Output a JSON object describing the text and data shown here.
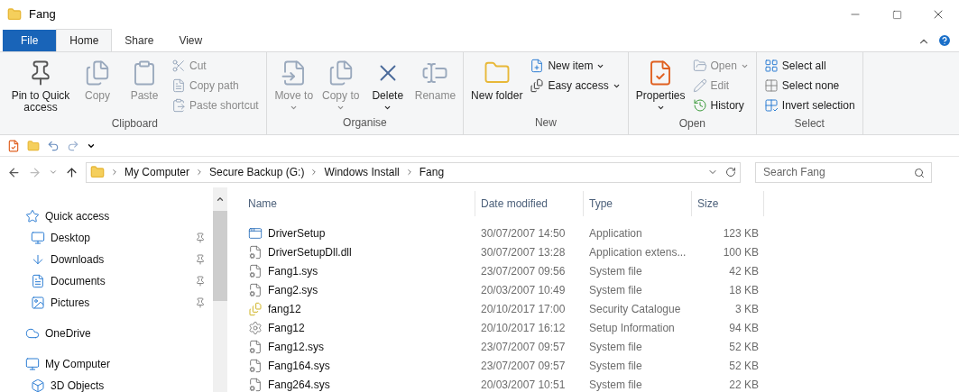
{
  "window": {
    "title": "Fang"
  },
  "tabs": [
    {
      "label": "File",
      "kind": "file",
      "selected": false
    },
    {
      "label": "Home",
      "kind": "tab",
      "selected": true
    },
    {
      "label": "Share",
      "kind": "tab",
      "selected": false
    },
    {
      "label": "View",
      "kind": "tab",
      "selected": false
    }
  ],
  "ribbon": [
    {
      "label": "Clipboard",
      "items": [
        {
          "kind": "large",
          "label": "Pin to Quick access",
          "disabled": false,
          "dropdown": false
        },
        {
          "kind": "large",
          "label": "Copy",
          "disabled": true,
          "dropdown": false
        },
        {
          "kind": "large",
          "label": "Paste",
          "disabled": true,
          "dropdown": false
        },
        {
          "kind": "small",
          "label": "Cut",
          "disabled": true,
          "dropdown": false
        },
        {
          "kind": "small",
          "label": "Copy path",
          "disabled": true,
          "dropdown": false
        },
        {
          "kind": "small",
          "label": "Paste shortcut",
          "disabled": true,
          "dropdown": false
        }
      ]
    },
    {
      "label": "Organise",
      "items": [
        {
          "kind": "large",
          "label": "Move to",
          "disabled": true,
          "dropdown": true
        },
        {
          "kind": "large",
          "label": "Copy to",
          "disabled": true,
          "dropdown": true
        },
        {
          "kind": "large",
          "label": "Delete",
          "disabled": false,
          "dropdown": true
        },
        {
          "kind": "large",
          "label": "Rename",
          "disabled": true,
          "dropdown": false
        }
      ]
    },
    {
      "label": "New",
      "items": [
        {
          "kind": "large",
          "label": "New folder",
          "disabled": false,
          "dropdown": false
        },
        {
          "kind": "small",
          "label": "New item",
          "disabled": false,
          "dropdown": true
        },
        {
          "kind": "small",
          "label": "Easy access",
          "disabled": false,
          "dropdown": true
        }
      ]
    },
    {
      "label": "Open",
      "items": [
        {
          "kind": "large",
          "label": "Properties",
          "disabled": false,
          "dropdown": true
        },
        {
          "kind": "small",
          "label": "Open",
          "disabled": true,
          "dropdown": true
        },
        {
          "kind": "small",
          "label": "Edit",
          "disabled": true,
          "dropdown": false
        },
        {
          "kind": "small",
          "label": "History",
          "disabled": false,
          "dropdown": false
        }
      ]
    },
    {
      "label": "Select",
      "items": [
        {
          "kind": "small",
          "label": "Select all",
          "disabled": false,
          "dropdown": false
        },
        {
          "kind": "small",
          "label": "Select none",
          "disabled": false,
          "dropdown": false
        },
        {
          "kind": "small",
          "label": "Invert selection",
          "disabled": false,
          "dropdown": false
        }
      ]
    }
  ],
  "address_bar": {
    "path": [
      "My Computer",
      "Secure Backup (G:)",
      "Windows Install",
      "Fang"
    ],
    "search": {
      "placeholder": "Search Fang"
    }
  },
  "sidebar": {
    "items": [
      {
        "label": "Quick access",
        "children": [
          {
            "label": "Desktop",
            "pinned": true
          },
          {
            "label": "Downloads",
            "pinned": true
          },
          {
            "label": "Documents",
            "pinned": true
          },
          {
            "label": "Pictures",
            "pinned": true
          }
        ]
      },
      {
        "label": "OneDrive"
      },
      {
        "label": "My Computer",
        "children": [
          {
            "label": "3D Objects",
            "pinned": false
          }
        ]
      }
    ]
  },
  "table": {
    "columns": [
      "Name",
      "Date modified",
      "Type",
      "Size"
    ],
    "rows": [
      {
        "kind": "app",
        "name": "DriverSetup",
        "date": "30/07/2007 14:50",
        "type": "Application",
        "size": "123 KB"
      },
      {
        "kind": "system",
        "name": "DriverSetupDll.dll",
        "date": "30/07/2007 13:28",
        "type": "Application extens...",
        "size": "100 KB"
      },
      {
        "kind": "system",
        "name": "Fang1.sys",
        "date": "23/07/2007 09:56",
        "type": "System file",
        "size": "42 KB"
      },
      {
        "kind": "system",
        "name": "Fang2.sys",
        "date": "20/03/2007 10:49",
        "type": "System file",
        "size": "18 KB"
      },
      {
        "kind": "catalog",
        "name": "fang12",
        "date": "20/10/2017 17:00",
        "type": "Security Catalogue",
        "size": "3 KB"
      },
      {
        "kind": "setup",
        "name": "Fang12",
        "date": "20/10/2017 16:12",
        "type": "Setup Information",
        "size": "94 KB"
      },
      {
        "kind": "system",
        "name": "Fang12.sys",
        "date": "23/07/2007 09:57",
        "type": "System file",
        "size": "52 KB"
      },
      {
        "kind": "system",
        "name": "Fang164.sys",
        "date": "23/07/2007 09:57",
        "type": "System file",
        "size": "52 KB"
      },
      {
        "kind": "system",
        "name": "Fang264.sys",
        "date": "20/03/2007 10:51",
        "type": "System file",
        "size": "22 KB"
      }
    ]
  }
}
